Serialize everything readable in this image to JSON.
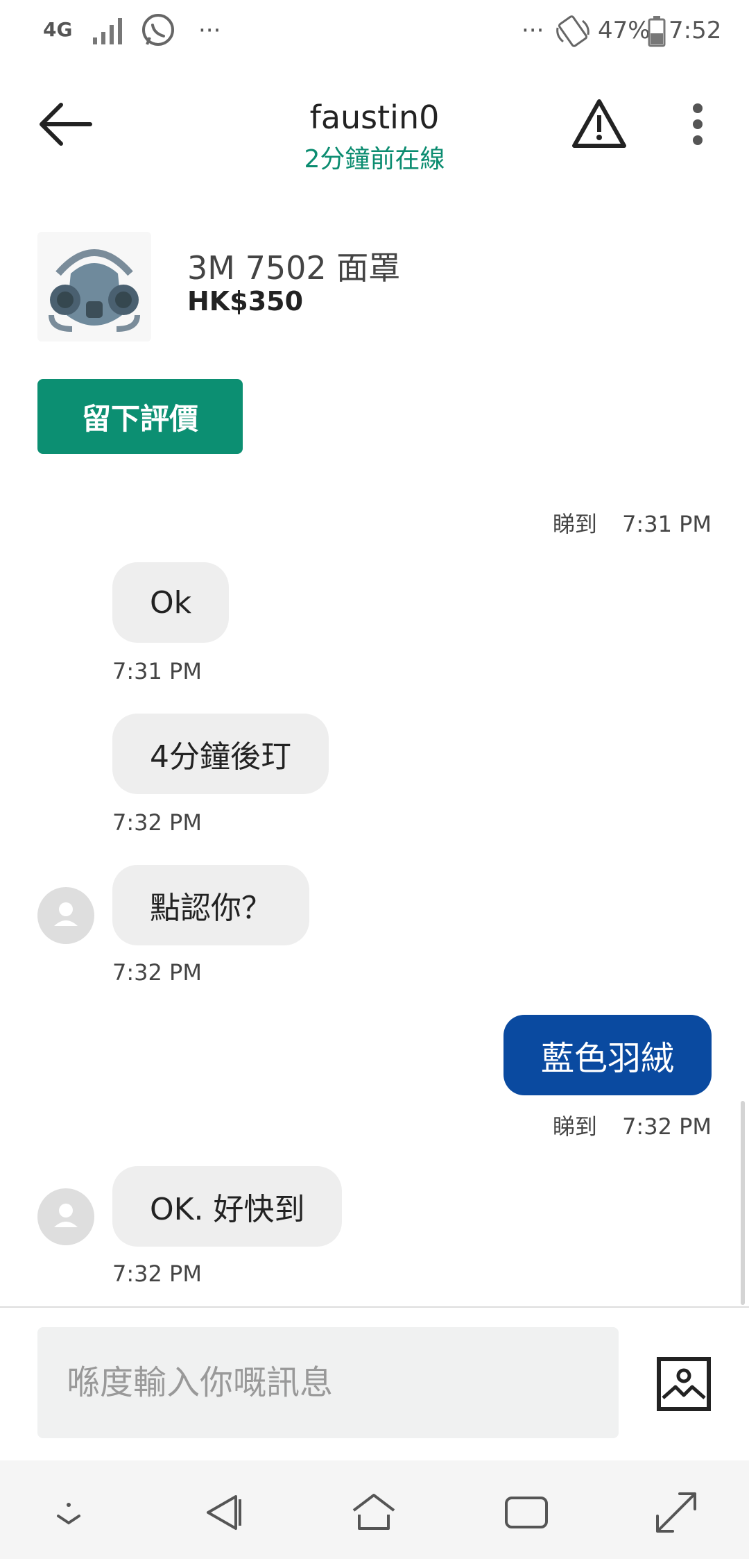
{
  "status_bar": {
    "network": "4G",
    "more_left": "···",
    "more_right": "···",
    "battery": "47%",
    "time": "7:52"
  },
  "header": {
    "title": "faustin0",
    "subtitle": "2分鐘前在線"
  },
  "product": {
    "name": "3M 7502 面罩",
    "price": "HK$350",
    "review_button": "留下評價"
  },
  "messages": [
    {
      "direction": "meta",
      "read": "睇到",
      "time": "7:31 PM"
    },
    {
      "direction": "in",
      "text": "Ok",
      "time": "7:31 PM"
    },
    {
      "direction": "in",
      "text": "4分鐘後玎",
      "time": "7:32 PM"
    },
    {
      "direction": "in",
      "text": "點認你？",
      "time": "7:32 PM",
      "avatar": true
    },
    {
      "direction": "out",
      "text": "藍色羽絨",
      "read": "睇到",
      "time": "7:32 PM"
    },
    {
      "direction": "in",
      "text": "OK. 好快到",
      "time": "7:32 PM",
      "avatar": true
    }
  ],
  "input": {
    "placeholder": "喺度輸入你嘅訊息"
  },
  "colors": {
    "accent_green": "#0c8f72",
    "sent_bubble": "#0a4aa0",
    "received_bubble": "#eeeeee"
  },
  "icons": [
    "back-arrow-icon",
    "warning-icon",
    "more-vert-icon",
    "image-icon",
    "person-icon"
  ]
}
